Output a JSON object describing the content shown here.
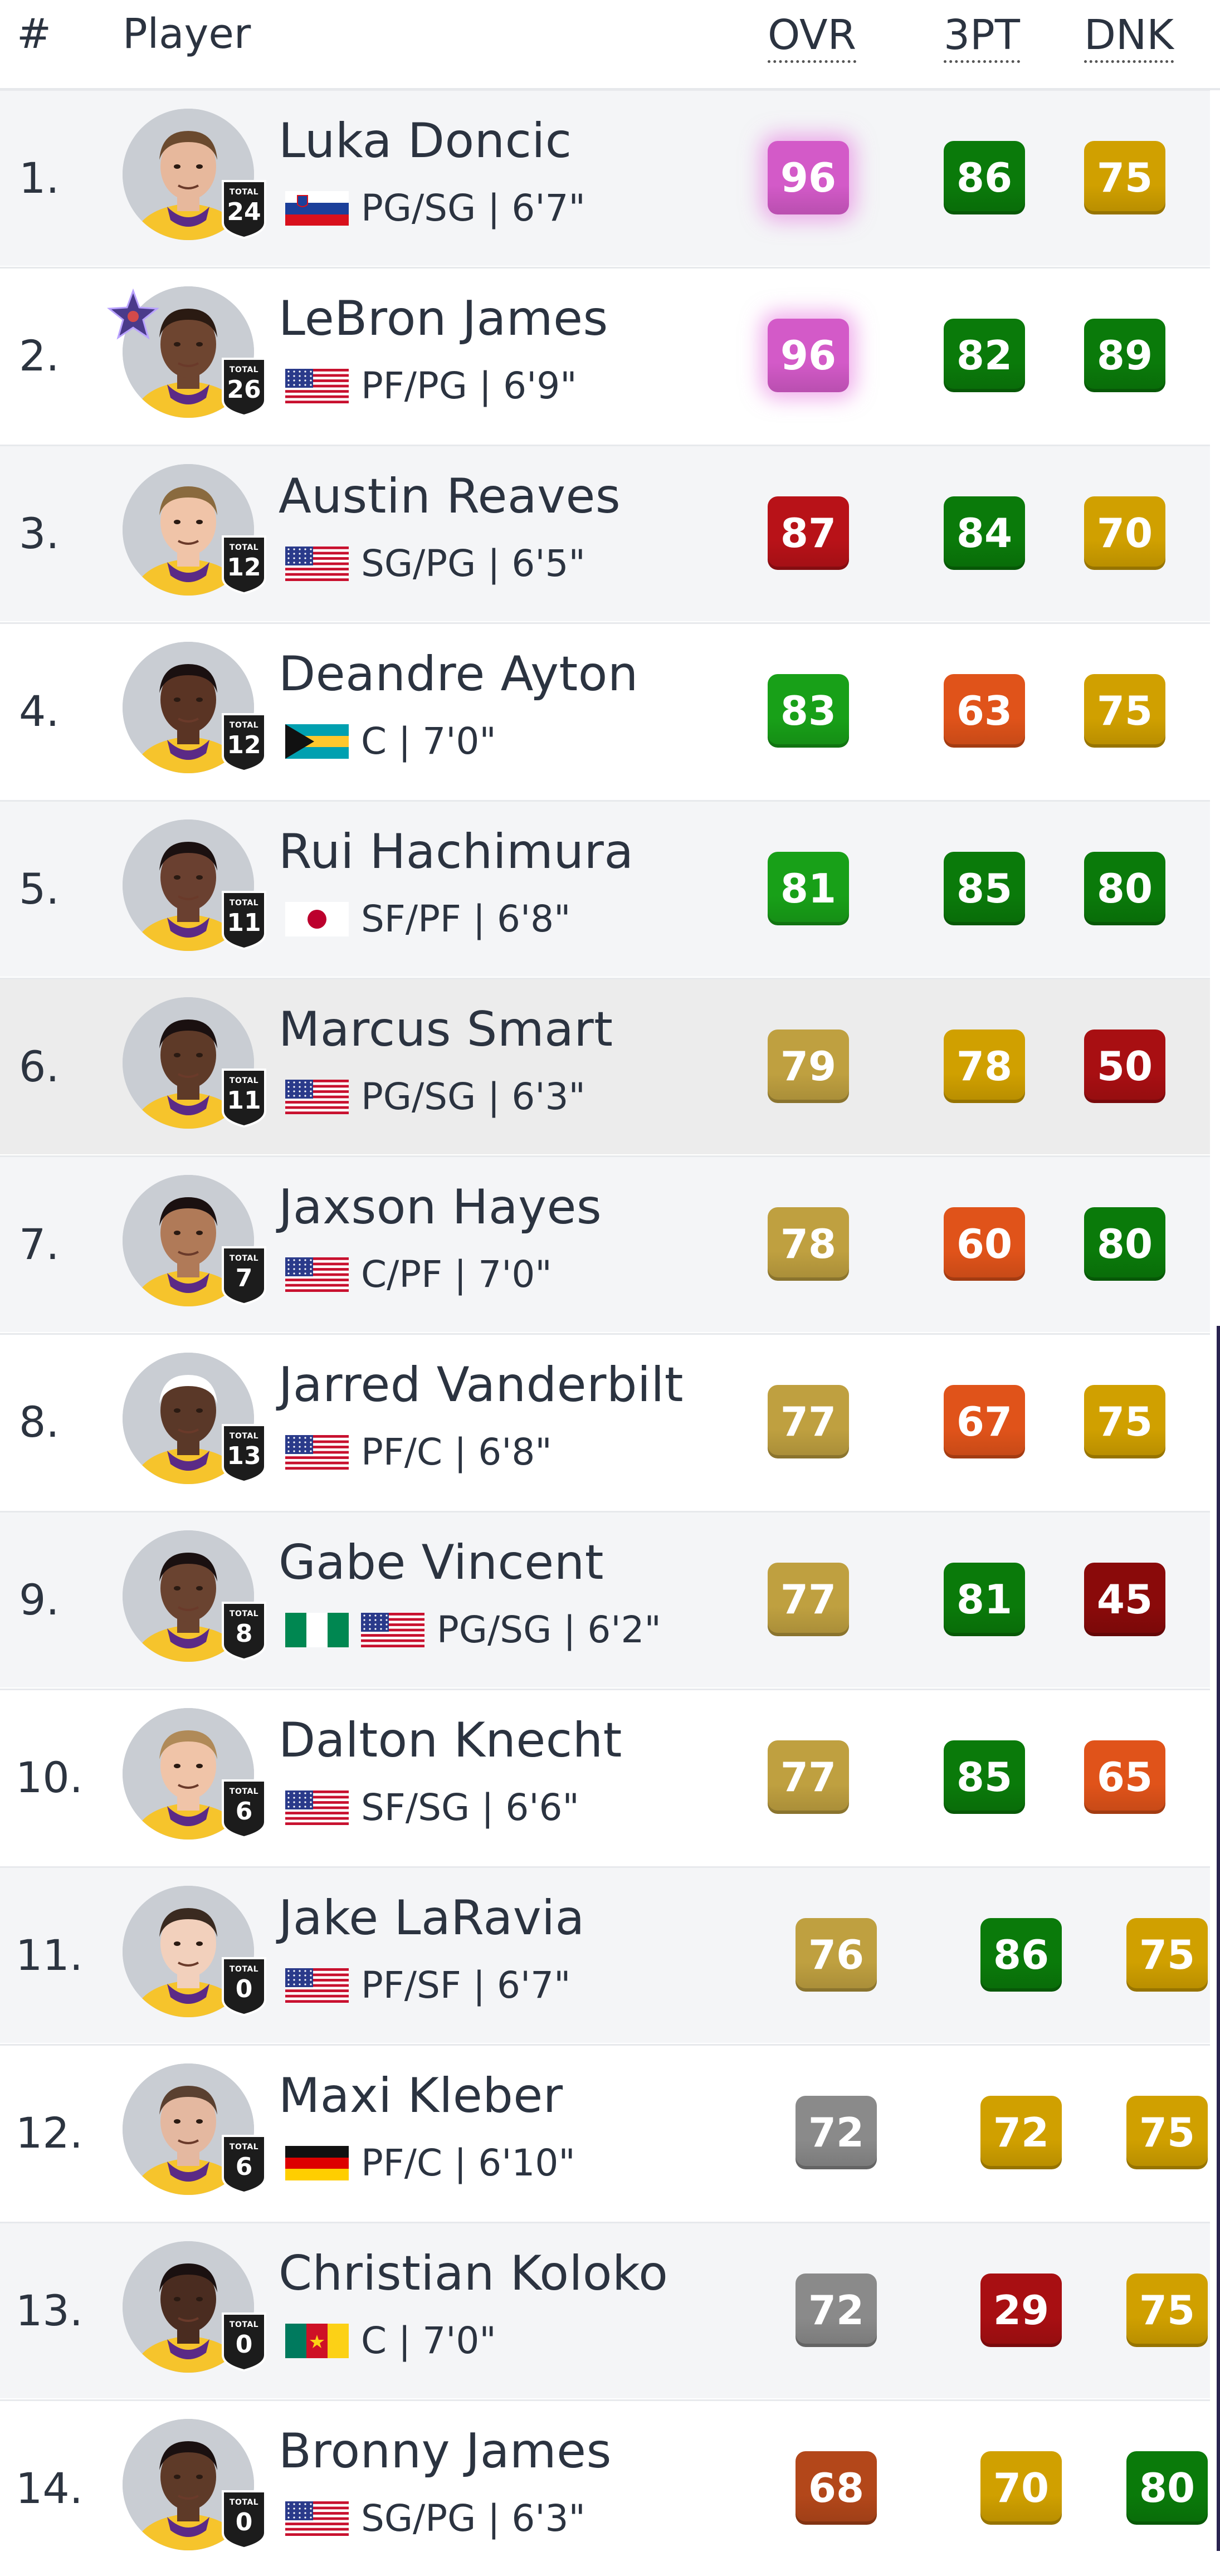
{
  "header": {
    "rank": "#",
    "player": "Player",
    "ovr": "OVR",
    "three_pt": "3PT",
    "dunk": "DNK"
  },
  "badge_caption": "TOTAL",
  "colors": {
    "pink": "#d35ac8",
    "darkred": "#a80f12",
    "red": "#b81218",
    "orange": "#e0531a",
    "gold": "#d0a000",
    "olive": "#bfa040",
    "green": "#0a7a0a",
    "lightgreen": "#18a018",
    "gray": "#8a8a8a",
    "brown": "#b3471a",
    "maroon": "#8a0a0a"
  },
  "players": [
    {
      "rank": "1.",
      "name": "Luka Doncic",
      "flags": [
        "slovenia"
      ],
      "pos": "PG/SG | 6'7\"",
      "total": "24",
      "ovr": "96",
      "ovr_color": "pink",
      "tpt": "86",
      "tpt_color": "green",
      "dnk": "75",
      "dnk_color": "gold",
      "skin": "#e7b89c",
      "hair": "#6b4a2e",
      "allstar": false
    },
    {
      "rank": "2.",
      "name": "LeBron James",
      "flags": [
        "usa"
      ],
      "pos": "PF/PG | 6'9\"",
      "total": "26",
      "ovr": "96",
      "ovr_color": "pink",
      "tpt": "82",
      "tpt_color": "green",
      "dnk": "89",
      "dnk_color": "green",
      "skin": "#6e4530",
      "hair": "#2a1a12",
      "allstar": true
    },
    {
      "rank": "3.",
      "name": "Austin Reaves",
      "flags": [
        "usa"
      ],
      "pos": "SG/PG | 6'5\"",
      "total": "12",
      "ovr": "87",
      "ovr_color": "red",
      "tpt": "84",
      "tpt_color": "green",
      "dnk": "70",
      "dnk_color": "gold",
      "skin": "#f0c4a8",
      "hair": "#8a6a3e",
      "allstar": false
    },
    {
      "rank": "4.",
      "name": "Deandre Ayton",
      "flags": [
        "bahamas"
      ],
      "pos": "C | 7'0\"",
      "total": "12",
      "ovr": "83",
      "ovr_color": "lightgreen",
      "tpt": "63",
      "tpt_color": "orange",
      "dnk": "75",
      "dnk_color": "gold",
      "skin": "#5a3424",
      "hair": "#1a1010",
      "allstar": false
    },
    {
      "rank": "5.",
      "name": "Rui Hachimura",
      "flags": [
        "japan"
      ],
      "pos": "SF/PF | 6'8\"",
      "total": "11",
      "ovr": "81",
      "ovr_color": "lightgreen",
      "tpt": "85",
      "tpt_color": "green",
      "dnk": "80",
      "dnk_color": "green",
      "skin": "#6a4030",
      "hair": "#1a1010",
      "allstar": false
    },
    {
      "rank": "6.",
      "name": "Marcus Smart",
      "flags": [
        "usa"
      ],
      "pos": "PG/SG | 6'3\"",
      "total": "11",
      "ovr": "79",
      "ovr_color": "olive",
      "tpt": "78",
      "tpt_color": "gold",
      "dnk": "50",
      "dnk_color": "darkred",
      "skin": "#5e3a28",
      "hair": "#1a1010",
      "allstar": false
    },
    {
      "rank": "7.",
      "name": "Jaxson Hayes",
      "flags": [
        "usa"
      ],
      "pos": "C/PF | 7'0\"",
      "total": "7",
      "ovr": "78",
      "ovr_color": "olive",
      "tpt": "60",
      "tpt_color": "orange",
      "dnk": "80",
      "dnk_color": "green",
      "skin": "#b07a58",
      "hair": "#1a1010",
      "allstar": false
    },
    {
      "rank": "8.",
      "name": "Jarred Vanderbilt",
      "flags": [
        "usa"
      ],
      "pos": "PF/C | 6'8\"",
      "total": "13",
      "ovr": "77",
      "ovr_color": "olive",
      "tpt": "67",
      "tpt_color": "orange",
      "dnk": "75",
      "dnk_color": "gold",
      "skin": "#5a3828",
      "hair": "#ffffff",
      "allstar": false
    },
    {
      "rank": "9.",
      "name": "Gabe Vincent",
      "flags": [
        "nigeria",
        "usa"
      ],
      "pos": "PG/SG | 6'2\"",
      "total": "8",
      "ovr": "77",
      "ovr_color": "olive",
      "tpt": "81",
      "tpt_color": "green",
      "dnk": "45",
      "dnk_color": "maroon",
      "skin": "#6a4330",
      "hair": "#1a1010",
      "allstar": false
    },
    {
      "rank": "10.",
      "name": "Dalton Knecht",
      "flags": [
        "usa"
      ],
      "pos": "SF/SG | 6'6\"",
      "total": "6",
      "ovr": "77",
      "ovr_color": "olive",
      "tpt": "85",
      "tpt_color": "green",
      "dnk": "65",
      "dnk_color": "orange",
      "skin": "#f0c4a8",
      "hair": "#b08a58",
      "allstar": false
    },
    {
      "rank": "11.",
      "name": "Jake LaRavia",
      "flags": [
        "usa"
      ],
      "pos": "PF/SF | 6'7\"",
      "total": "0",
      "ovr": "76",
      "ovr_color": "olive",
      "tpt": "86",
      "tpt_color": "green",
      "dnk": "75",
      "dnk_color": "gold",
      "skin": "#f2d0bc",
      "hair": "#3a2a20",
      "allstar": false
    },
    {
      "rank": "12.",
      "name": "Maxi Kleber",
      "flags": [
        "germany"
      ],
      "pos": "PF/C | 6'10\"",
      "total": "6",
      "ovr": "72",
      "ovr_color": "gray",
      "tpt": "72",
      "tpt_color": "gold",
      "dnk": "75",
      "dnk_color": "gold",
      "skin": "#e4b8a0",
      "hair": "#5a4030",
      "allstar": false
    },
    {
      "rank": "13.",
      "name": "Christian Koloko",
      "flags": [
        "cameroon"
      ],
      "pos": "C | 7'0\"",
      "total": "0",
      "ovr": "72",
      "ovr_color": "gray",
      "tpt": "29",
      "tpt_color": "darkred",
      "dnk": "75",
      "dnk_color": "gold",
      "skin": "#4a2c20",
      "hair": "#1a1010",
      "allstar": false
    },
    {
      "rank": "14.",
      "name": "Bronny James",
      "flags": [
        "usa"
      ],
      "pos": "SG/PG | 6'3\"",
      "total": "0",
      "ovr": "68",
      "ovr_color": "brown",
      "tpt": "70",
      "tpt_color": "gold",
      "dnk": "80",
      "dnk_color": "green",
      "skin": "#5e3a28",
      "hair": "#1a1010",
      "allstar": false
    }
  ]
}
